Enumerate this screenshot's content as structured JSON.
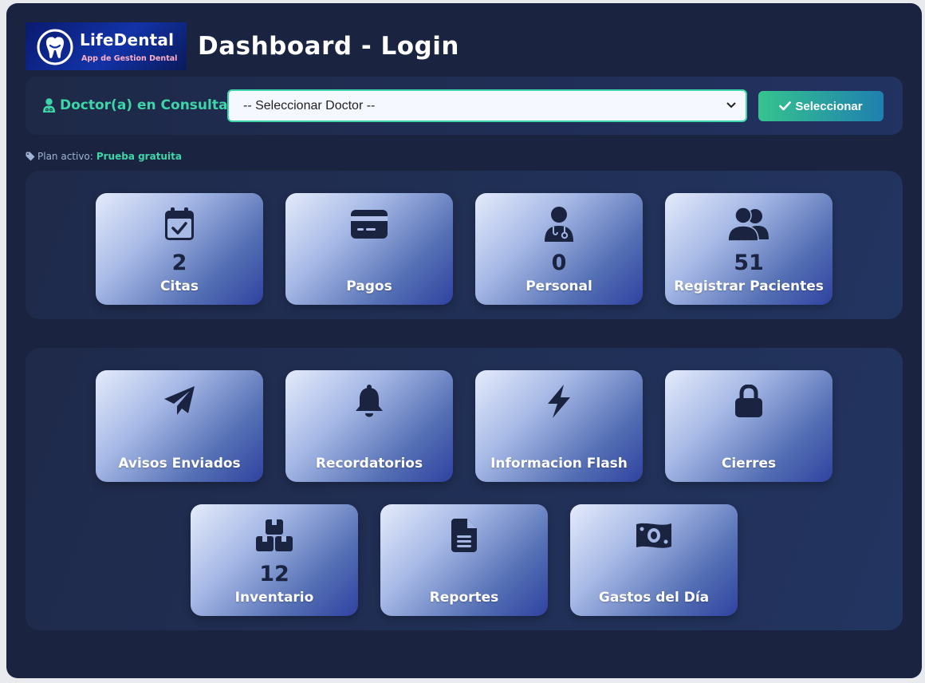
{
  "header": {
    "brand": "LifeDental",
    "tagline": "App de Gestion Dental",
    "title": "Dashboard - Login"
  },
  "doctor": {
    "label": "Doctor(a) en Consulta:",
    "select_value": "-- Seleccionar Doctor --",
    "button_label": "Seleccionar"
  },
  "plan": {
    "label": "Plan activo:",
    "value": "Prueba gratuita"
  },
  "stats": [
    {
      "label": "Citas",
      "count": "2",
      "icon": "calendar-check-icon"
    },
    {
      "label": "Pagos",
      "count": "",
      "icon": "credit-card-icon"
    },
    {
      "label": "Personal",
      "count": "0",
      "icon": "doctor-icon"
    },
    {
      "label": "Registrar Pacientes",
      "count": "51",
      "icon": "users-icon"
    }
  ],
  "modules": [
    {
      "label": "Avisos Enviados",
      "count": "",
      "icon": "paper-plane-icon"
    },
    {
      "label": "Recordatorios",
      "count": "",
      "icon": "bell-icon"
    },
    {
      "label": "Informacion Flash",
      "count": "",
      "icon": "bolt-icon"
    },
    {
      "label": "Cierres",
      "count": "",
      "icon": "lock-icon"
    },
    {
      "label": "Inventario",
      "count": "12",
      "icon": "boxes-icon"
    },
    {
      "label": "Reportes",
      "count": "",
      "icon": "file-icon"
    },
    {
      "label": "Gastos del Día",
      "count": "",
      "icon": "money-bill-icon"
    }
  ],
  "colors": {
    "background": "#1a2340",
    "accent": "#3dd6a8",
    "icon": "#1a2340"
  }
}
